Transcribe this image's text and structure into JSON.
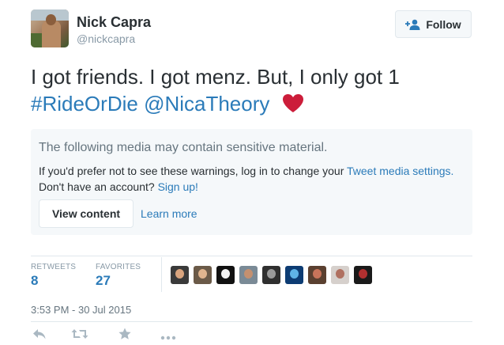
{
  "user": {
    "name": "Nick Capra",
    "handle": "@nickcapra"
  },
  "follow_button": {
    "label": "Follow",
    "icon": "add-user-icon"
  },
  "tweet": {
    "text": "I got friends. I got menz. But, I only got 1",
    "hashtag": "#RideOrDie",
    "mention": "@NicaTheory",
    "emoji": "heart-icon",
    "heart_color": "#cc1d3a"
  },
  "media_warning": {
    "title": "The following media may contain sensitive material.",
    "line1_prefix": "If you'd prefer not to see these warnings, log in to change your",
    "line1_link": "Tweet media settings.",
    "line2_prefix": "Don't have an account?",
    "line2_link": "Sign up!",
    "view_button": "View content",
    "learn_more": "Learn more"
  },
  "stats": {
    "retweets_label": "RETWEETS",
    "retweets_value": "8",
    "favorites_label": "FAVORITES",
    "favorites_value": "27"
  },
  "favoriters": [
    {
      "bg": "#3a3a3a",
      "face": "#d9a47e"
    },
    {
      "bg": "#6b5a48",
      "face": "#e0b48e"
    },
    {
      "bg": "#111111",
      "face": "#f2f2f2"
    },
    {
      "bg": "#7a8a96",
      "face": "#c49070"
    },
    {
      "bg": "#2f2f2f",
      "face": "#9a9a9a"
    },
    {
      "bg": "#0d3c73",
      "face": "#5fb3e6"
    },
    {
      "bg": "#5a4030",
      "face": "#c8745a"
    },
    {
      "bg": "#d6d0cc",
      "face": "#b07060"
    },
    {
      "bg": "#1a1a1a",
      "face": "#b03030"
    }
  ],
  "timestamp": "3:53 PM - 30 Jul 2015",
  "actions": {
    "reply": "reply-icon",
    "retweet": "retweet-icon",
    "favorite": "star-icon",
    "more": "more-icon"
  },
  "colors": {
    "link": "#2b7bb9",
    "muted": "#8899a6",
    "border": "#e1e8ed",
    "panel_bg": "#f5f8fa"
  }
}
